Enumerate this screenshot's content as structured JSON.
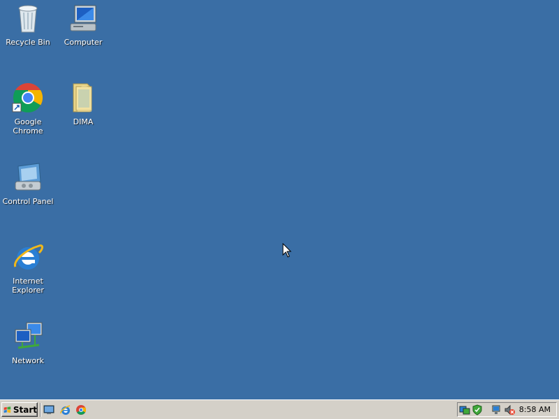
{
  "desktop": {
    "background_color": "#3a6ea5",
    "icons": [
      {
        "label": "Recycle Bin",
        "icon": "recycle-bin-icon"
      },
      {
        "label": "Computer",
        "icon": "computer-icon"
      },
      {
        "label": "Google Chrome",
        "icon": "chrome-icon"
      },
      {
        "label": "DIMA",
        "icon": "folder-icon"
      },
      {
        "label": "Control Panel",
        "icon": "control-panel-icon"
      },
      {
        "label": "Internet Explorer",
        "icon": "internet-explorer-icon"
      },
      {
        "label": "Network",
        "icon": "network-icon"
      }
    ]
  },
  "taskbar": {
    "start_label": "Start",
    "quick_launch": [
      {
        "icon": "show-desktop-icon"
      },
      {
        "icon": "internet-explorer-icon"
      },
      {
        "icon": "chrome-icon"
      }
    ],
    "tray": {
      "icons": [
        "network-status-icon",
        "security-shield-icon",
        "network-connection-icon",
        "volume-muted-icon"
      ],
      "clock": "8:58 AM"
    }
  }
}
